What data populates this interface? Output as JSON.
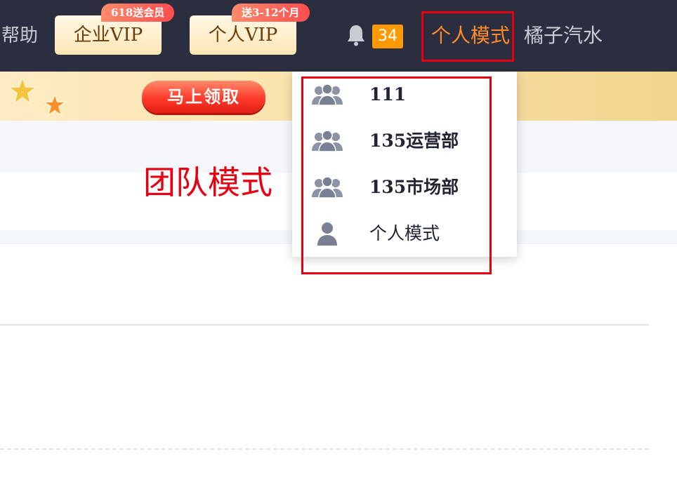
{
  "topbar": {
    "help": "帮助",
    "enterprise_vip": {
      "label": "企业VIP",
      "badge": "618送会员"
    },
    "personal_vip": {
      "label": "个人VIP",
      "badge": "送3-12个月"
    },
    "notification_count": "34",
    "mode_switch": "个人模式",
    "username": "橘子汽水"
  },
  "banner": {
    "claim_button": "马上领取"
  },
  "annotation": {
    "team_mode": "团队模式"
  },
  "dropdown": {
    "items": [
      {
        "label": "111",
        "icon": "team-icon"
      },
      {
        "label": "135运营部",
        "icon": "team-icon"
      },
      {
        "label": "135市场部",
        "icon": "team-icon"
      },
      {
        "label": "个人模式",
        "icon": "person-icon"
      }
    ]
  },
  "colors": {
    "topbar_bg": "#2b2e3f",
    "accent_orange": "#ff8a2a",
    "annotation_red": "#e60012",
    "badge_orange": "#ff9900"
  }
}
